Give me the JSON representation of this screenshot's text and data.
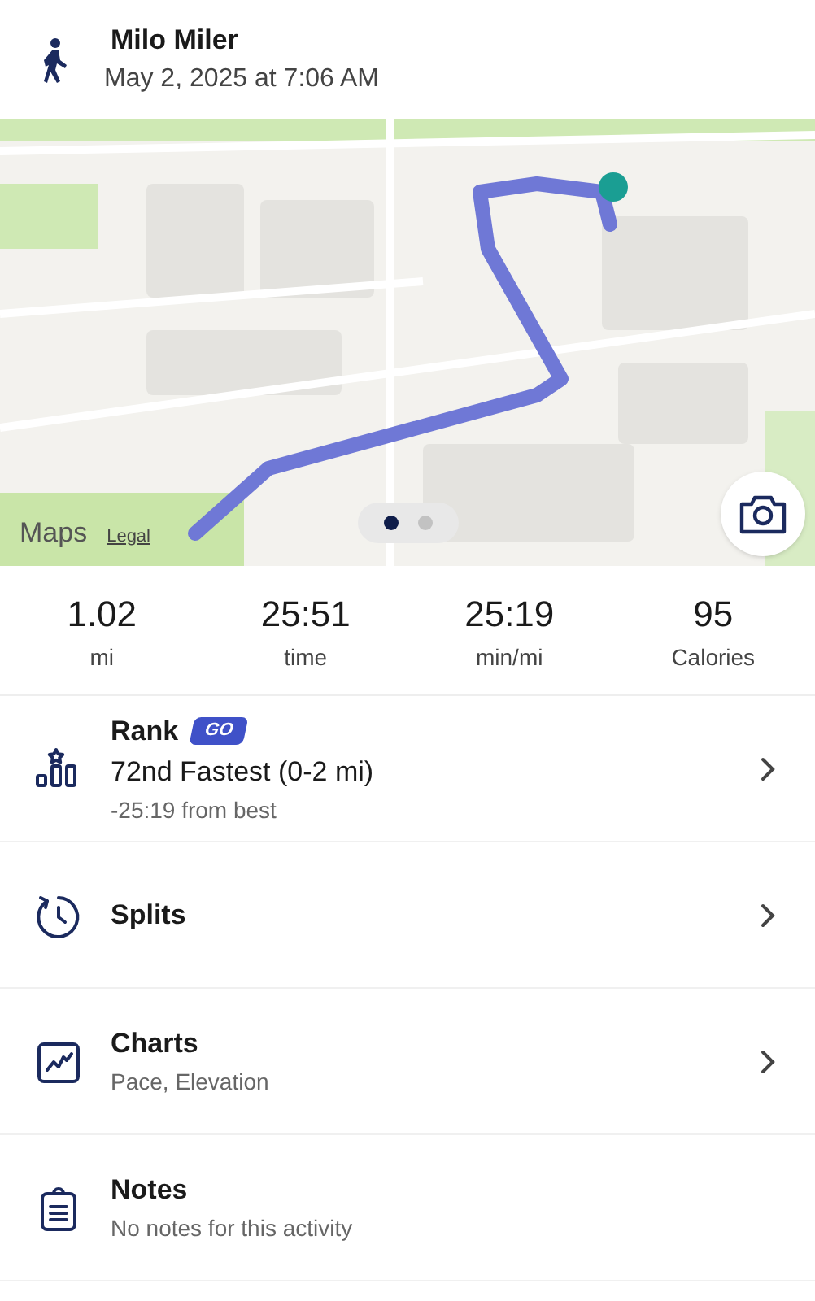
{
  "header": {
    "name": "Milo Miler",
    "date": "May 2, 2025 at 7:06 AM"
  },
  "map": {
    "kind": "picture",
    "attribution": "Maps",
    "legal": "Legal",
    "pages": [
      {
        "selected": true
      },
      {
        "selected": false
      }
    ]
  },
  "stats": [
    {
      "value": "1.02",
      "unit": "mi"
    },
    {
      "value": "25:51",
      "unit": "time"
    },
    {
      "value": "25:19",
      "unit": "min/mi"
    },
    {
      "value": "95",
      "unit": "Calories"
    }
  ],
  "rows": [
    {
      "kind": "rank",
      "title": "Rank",
      "badge": "GO",
      "headline": "72nd Fastest (0-2 mi)",
      "subtitle": "-25:19 from best",
      "chevron": true
    },
    {
      "kind": "splits",
      "title": "Splits",
      "chevron": true
    },
    {
      "kind": "charts",
      "title": "Charts",
      "subtitle": "Pace, Elevation",
      "chevron": true
    },
    {
      "kind": "notes",
      "title": "Notes",
      "subtitle": "No notes for this activity",
      "chevron": false
    }
  ]
}
